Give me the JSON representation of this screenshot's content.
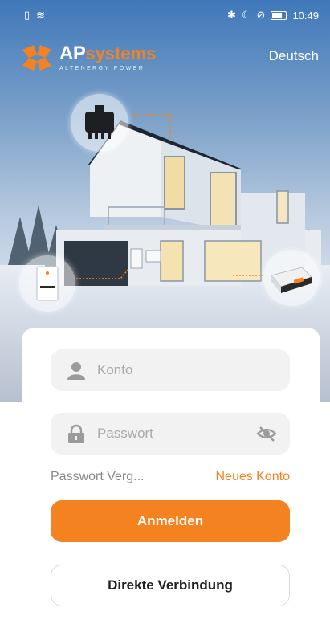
{
  "status_bar": {
    "time": "10:49"
  },
  "brand": {
    "name_ap": "AP",
    "name_systems": "systems",
    "tagline": "ALTENERGY POWER",
    "accent_color": "#f58220"
  },
  "header": {
    "language_label": "Deutsch"
  },
  "login": {
    "account_placeholder": "Konto",
    "password_placeholder": "Passwort",
    "forgot_password_label": "Passwort Verg...",
    "new_account_label": "Neues Konto",
    "login_button_label": "Anmelden",
    "direct_connection_label": "Direkte Verbindung"
  },
  "icons": {
    "account": "user-icon",
    "password": "lock-icon",
    "show_password": "eye-slash-icon"
  }
}
